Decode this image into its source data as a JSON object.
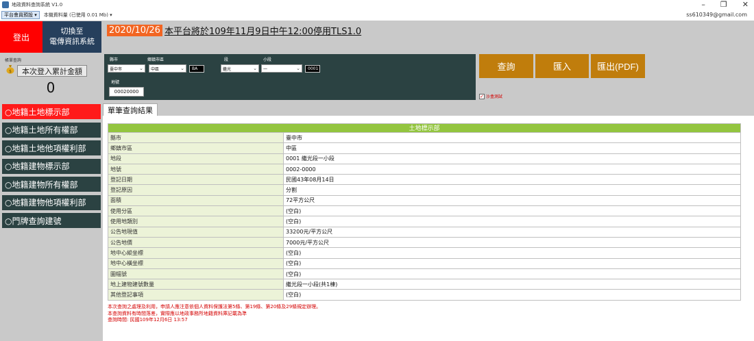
{
  "window": {
    "title": "地政資料查詢系統 V1.0",
    "controls": [
      "–",
      "❐",
      "✕"
    ]
  },
  "menubar": {
    "platform_select": "平台會員預設 ▾",
    "storage": "本機資料量 (已使用 0.01 Mb) ▾",
    "user_email": "ss610349@gmail.com"
  },
  "left": {
    "logout_label": "登出",
    "switch_line1": "切換至",
    "switch_line2": "電傳資訊系統",
    "bill_caption": "帳單查詢",
    "total_label": "本次登入累計金額",
    "total_value": "0"
  },
  "nav": {
    "items": [
      {
        "label": "○地籍土地標示部",
        "active": true
      },
      {
        "label": "○地籍土地所有權部",
        "active": false
      },
      {
        "label": "○地籍土地他項權利部",
        "active": false
      },
      {
        "label": "○地籍建物標示部",
        "active": false
      },
      {
        "label": "○地籍建物所有權部",
        "active": false
      },
      {
        "label": "○地籍建物他項權利部",
        "active": false
      },
      {
        "label": "○門牌查詢建號",
        "active": false
      }
    ]
  },
  "announcement": {
    "date": "2020/10/26",
    "text": "本平台將於109年11月9日中午12:00停用TLS1.0"
  },
  "filter": {
    "county_label": "縣市",
    "county_value": "臺中市",
    "district_label": "鄉鎮市區",
    "district_value": "中區",
    "district_code": "BA",
    "section_label": "段",
    "section_value": "繼光",
    "subsection_label": "小段",
    "subsection_value": "一",
    "section_code": "0001",
    "lot_label": "地號",
    "lot_value": "00020000"
  },
  "actions": {
    "query": "查詢",
    "import": "匯入",
    "export_pdf": "匯出(PDF)",
    "test_checkbox": "沙盒測試"
  },
  "tab": {
    "label": "單筆查詢結果"
  },
  "table": {
    "header": "土地標示部",
    "rows": [
      {
        "label": "縣市",
        "value": "臺中市"
      },
      {
        "label": "鄉鎮市區",
        "value": "中區"
      },
      {
        "label": "地段",
        "value": "0001 繼光段一小段"
      },
      {
        "label": "地號",
        "value": "0002-0000"
      },
      {
        "label": "登記日期",
        "value": "民國43年08月14日"
      },
      {
        "label": "登記原因",
        "value": "分割"
      },
      {
        "label": "面積",
        "value": "72平方公尺"
      },
      {
        "label": "使用分區",
        "value": "(空白)"
      },
      {
        "label": "使用地類別",
        "value": "(空白)"
      },
      {
        "label": "公告地現值",
        "value": "33200元/平方公尺"
      },
      {
        "label": "公告地價",
        "value": "7000元/平方公尺"
      },
      {
        "label": "地中心縱坐標",
        "value": "(空白)"
      },
      {
        "label": "地中心橫坐標",
        "value": "(空白)"
      },
      {
        "label": "圖幅號",
        "value": "(空白)"
      },
      {
        "label": "地上建物建號數量",
        "value": "繼光段一小段(共1棟)"
      },
      {
        "label": "其他登記事項",
        "value": "(空白)"
      }
    ]
  },
  "notes": {
    "line1": "本次查詢之處理及利用，申請人應注意依個人資料保護法第5條、第19條、第20條及29條規定辦理。",
    "line2": "本查詢資料有時間落差，實際應以地政事務所地籍資料庫記載為準",
    "line3": "查詢時間: 民國109年12月6日 13:57"
  },
  "colors": {
    "logout": "#ff0000",
    "switch": "#263f5c",
    "nav": "#2b4242",
    "nav_active": "#ff1a1a",
    "action": "#c07d0c",
    "table_header": "#93c53f",
    "label_cell": "#ecf3d8",
    "announcement_date": "#f26522"
  }
}
